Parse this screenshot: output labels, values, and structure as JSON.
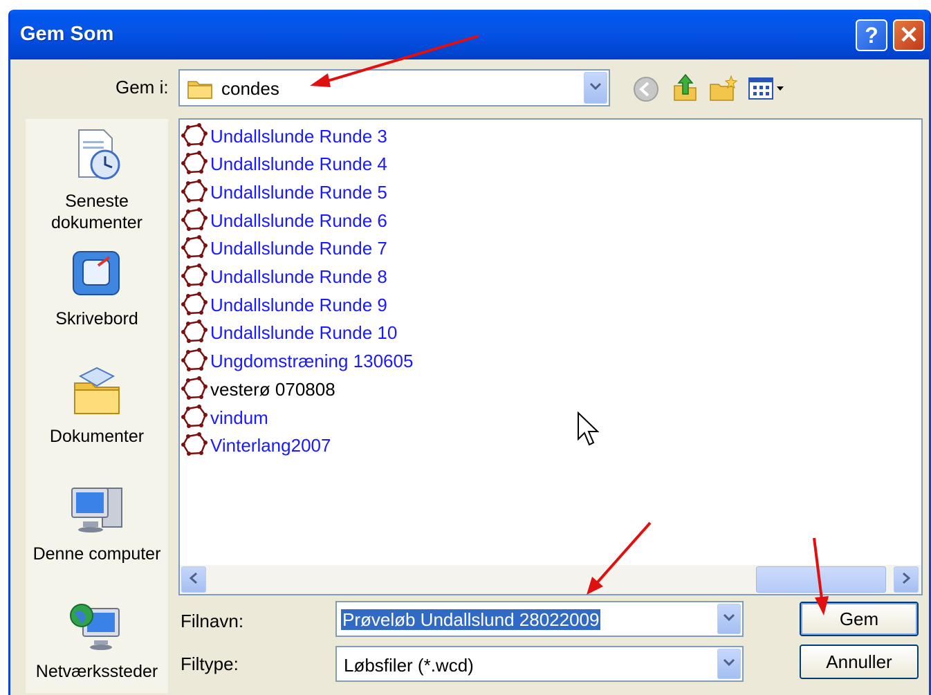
{
  "dialog": {
    "title": "Gem Som"
  },
  "titlebar": {
    "help_glyph": "?",
    "close_glyph": "✕"
  },
  "save_in": {
    "label": "Gem i:",
    "value": "condes"
  },
  "toolbar": {
    "icons": [
      "back-icon",
      "up-folder-icon",
      "new-folder-icon",
      "view-menu-icon"
    ]
  },
  "places": [
    {
      "label": "Seneste dokumenter",
      "icon": "recent-documents-icon"
    },
    {
      "label": "Skrivebord",
      "icon": "desktop-icon"
    },
    {
      "label": "Dokumenter",
      "icon": "my-documents-icon"
    },
    {
      "label": "Denne computer",
      "icon": "my-computer-icon"
    },
    {
      "label": "Netværkssteder",
      "icon": "network-places-icon"
    }
  ],
  "files": [
    {
      "name": "Undallslunde Runde 3",
      "color": "#1a1aff"
    },
    {
      "name": "Undallslunde Runde 4",
      "color": "#1a1aff"
    },
    {
      "name": "Undallslunde Runde 5",
      "color": "#1a1aff"
    },
    {
      "name": "Undallslunde Runde 6",
      "color": "#1a1aff"
    },
    {
      "name": "Undallslunde Runde 7",
      "color": "#1a1aff"
    },
    {
      "name": "Undallslunde Runde 8",
      "color": "#1a1aff"
    },
    {
      "name": "Undallslunde Runde 9",
      "color": "#1a1aff"
    },
    {
      "name": "Undallslunde Runde 10",
      "color": "#1a1aff"
    },
    {
      "name": "Ungdomstræning 130605",
      "color": "#1a1aff"
    },
    {
      "name": "vesterø 070808",
      "color": "#000000"
    },
    {
      "name": "vindum",
      "color": "#1a1aff"
    },
    {
      "name": "Vinterlang2007",
      "color": "#1a1aff"
    }
  ],
  "filename": {
    "label": "Filnavn:",
    "value": "Prøveløb Undallslund 28022009"
  },
  "filetype": {
    "label": "Filtype:",
    "value": "Løbsfiler (*.wcd)"
  },
  "buttons": {
    "save": "Gem",
    "cancel": "Annuller"
  },
  "colors": {
    "title_bar": "#0653e6",
    "annotation_arrow": "#e01010",
    "selection": "#316ac5"
  }
}
